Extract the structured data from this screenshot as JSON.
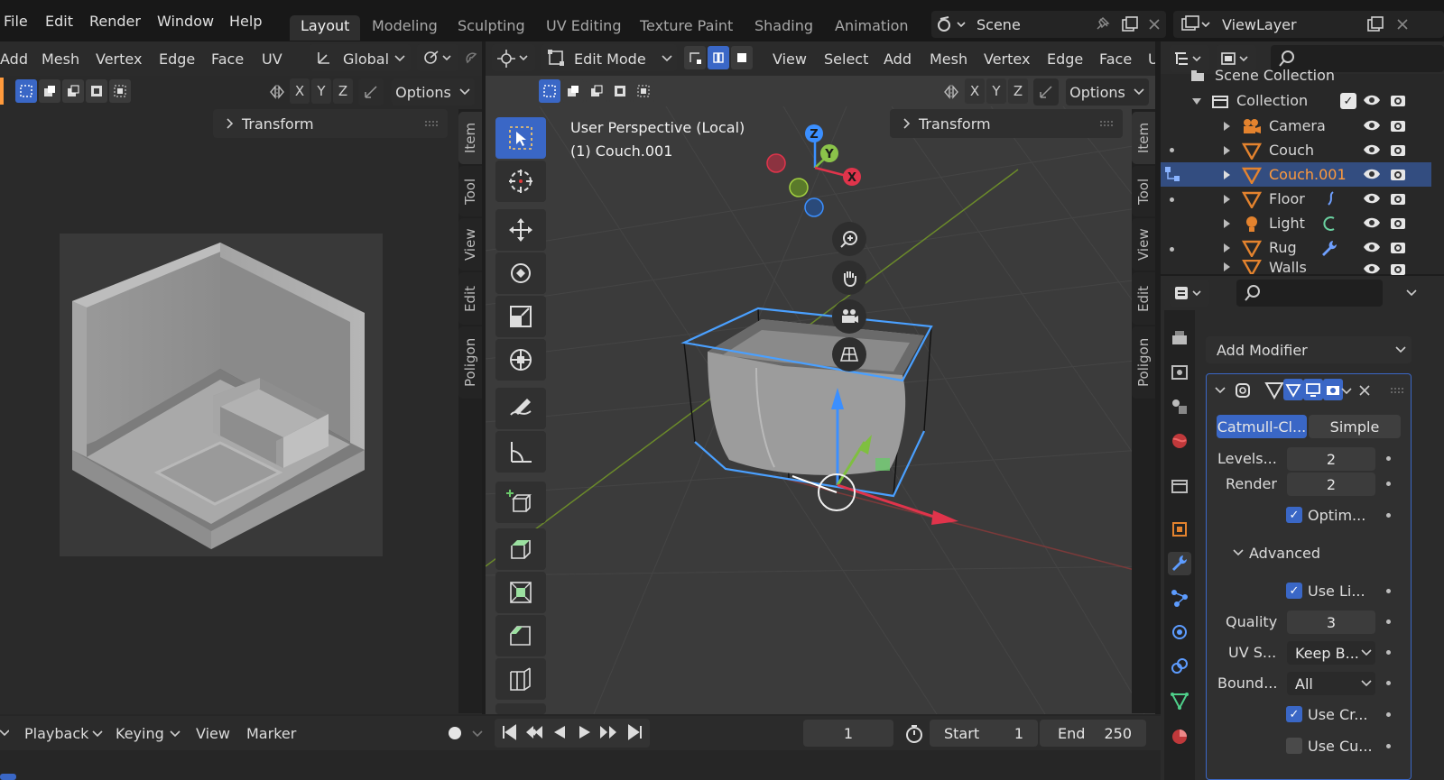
{
  "menu": {
    "file": "File",
    "edit": "Edit",
    "render": "Render",
    "window": "Window",
    "help": "Help"
  },
  "workspaces": [
    "Layout",
    "Modeling",
    "Sculpting",
    "UV Editing",
    "Texture Paint",
    "Shading",
    "Animation"
  ],
  "scene": {
    "name": "Scene"
  },
  "view_layer": {
    "name": "ViewLayer"
  },
  "uv_editor": {
    "menus": {
      "add": "Add",
      "mesh": "Mesh",
      "vertex": "Vertex",
      "edge": "Edge",
      "face": "Face",
      "uv": "UV"
    },
    "transform_space": "Global",
    "axes": [
      "X",
      "Y",
      "Z"
    ],
    "options": "Options",
    "transform_panel": "Transform",
    "side_tabs": [
      "Item",
      "Tool",
      "View",
      "Edit",
      "Poligon"
    ]
  },
  "viewport": {
    "mode": "Edit Mode",
    "menus": {
      "view": "View",
      "select": "Select",
      "add": "Add",
      "mesh": "Mesh",
      "vertex": "Vertex",
      "edge": "Edge",
      "face": "Face",
      "more": "U"
    },
    "axes": [
      "X",
      "Y",
      "Z"
    ],
    "options": "Options",
    "perspective": "User Perspective (Local)",
    "object_label": "(1) Couch.001",
    "transform_panel": "Transform",
    "side_tabs": [
      "Item",
      "Tool",
      "View",
      "Edit",
      "Poligon"
    ],
    "gizmo_labels": {
      "z": "Z",
      "y": "Y",
      "x": "X"
    }
  },
  "outliner": {
    "scene_collection": "Scene Collection",
    "collection": "Collection",
    "items": [
      {
        "name": "Camera",
        "selected": false
      },
      {
        "name": "Couch",
        "selected": false
      },
      {
        "name": "Couch.001",
        "selected": true
      },
      {
        "name": "Floor",
        "selected": false
      },
      {
        "name": "Light",
        "selected": false
      },
      {
        "name": "Rug",
        "selected": false
      },
      {
        "name": "Walls",
        "selected": false
      }
    ]
  },
  "properties": {
    "add_modifier": "Add Modifier",
    "subdiv_type_a": "Catmull-Cl...",
    "subdiv_type_b": "Simple",
    "levels_label": "Levels...",
    "levels_value": "2",
    "render_label": "Render",
    "render_value": "2",
    "optimal_label": "Optim...",
    "advanced_label": "Advanced",
    "use_limit_label": "Use Li...",
    "quality_label": "Quality",
    "quality_value": "3",
    "uv_smooth_label": "UV S...",
    "uv_smooth_value": "Keep B...",
    "boundary_label": "Bound...",
    "boundary_value": "All",
    "use_creases_label": "Use Cr...",
    "use_custom_label": "Use Cu..."
  },
  "timeline": {
    "playback": "Playback",
    "keying": "Keying",
    "view": "View",
    "marker": "Marker",
    "current_frame": "1",
    "start_label": "Start",
    "start_value": "1",
    "end_label": "End",
    "end_value": "250"
  },
  "colors": {
    "accent": "#3a67c6",
    "selected_text": "#ff9a3c",
    "object_orange": "#e4832e"
  }
}
